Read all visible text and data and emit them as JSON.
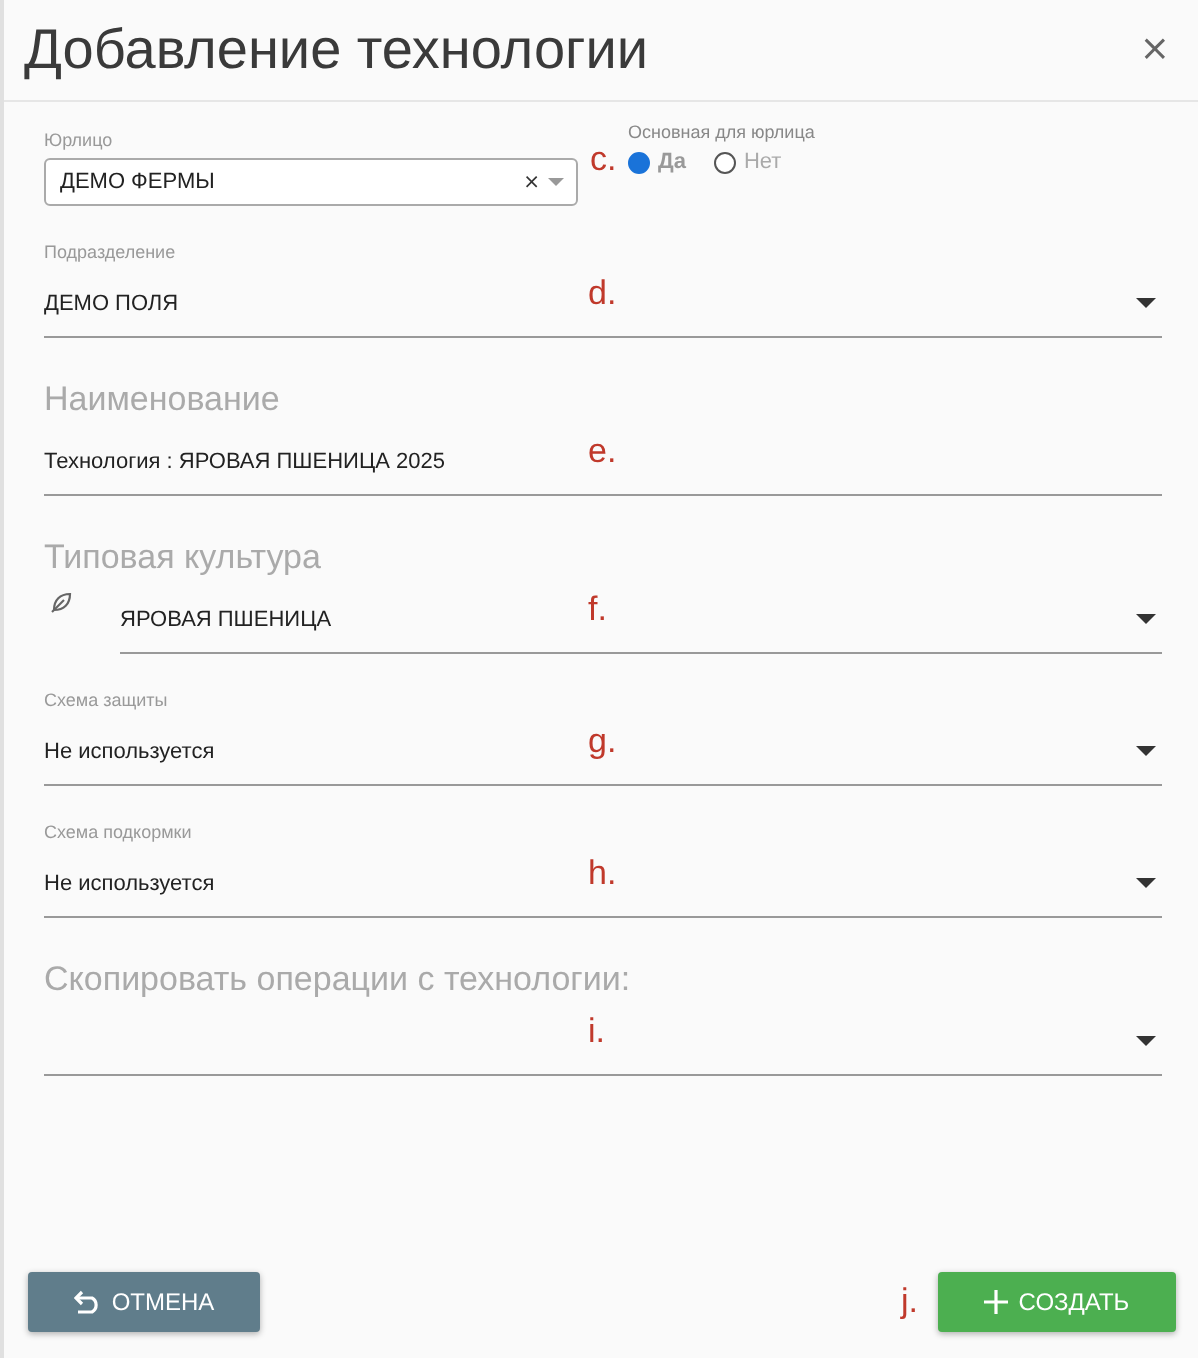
{
  "dialog": {
    "title": "Добавление технологии",
    "close": "×"
  },
  "legal_entity": {
    "label": "Юрлицо",
    "value": "ДЕМО ФЕРМЫ",
    "clear": "×",
    "annotation": "c."
  },
  "primary_for_entity": {
    "label": "Основная для юрлица",
    "options": [
      {
        "label": "Да",
        "selected": true
      },
      {
        "label": "Нет",
        "selected": false
      }
    ]
  },
  "fields": [
    {
      "kind": "select",
      "label": "Подразделение",
      "heading": false,
      "value": "ДЕМО ПОЛЯ",
      "annotation": "d."
    },
    {
      "kind": "input",
      "label": "Наименование",
      "heading": true,
      "value": "Технология : ЯРОВАЯ ПШЕНИЦА 2025",
      "annotation": "e."
    },
    {
      "kind": "select",
      "label": "Типовая культура",
      "heading": true,
      "icon": true,
      "value": "ЯРОВАЯ ПШЕНИЦА",
      "annotation": "f."
    },
    {
      "kind": "select",
      "label": "Схема защиты",
      "heading": false,
      "value": "Не используется",
      "annotation": "g."
    },
    {
      "kind": "select",
      "label": "Схема подкормки",
      "heading": false,
      "value": "Не используется",
      "annotation": "h."
    },
    {
      "kind": "select",
      "label": "Скопировать операции с технологии:",
      "heading": true,
      "annotation": "i."
    }
  ],
  "buttons": [
    {
      "kind": "cancel",
      "label": "ОТМЕНА"
    },
    {
      "kind": "create",
      "label": "СОЗДАТЬ",
      "annotation": "j."
    }
  ]
}
